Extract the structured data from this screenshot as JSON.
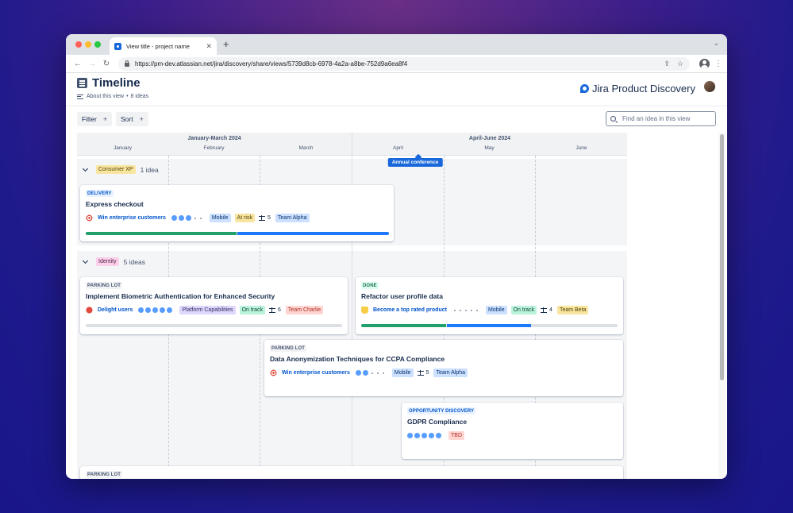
{
  "browser": {
    "tab_title": "View title - project name",
    "url": "https://pm-dev.atlassian.net/jira/discovery/share/views/5739d8cb-6978-4a2a-a8be-752d9a6ea8f4"
  },
  "header": {
    "title": "Timeline",
    "about_label": "About this view",
    "ideas_count": "8 ideas",
    "brand": "Jira Product Discovery"
  },
  "toolbar": {
    "filter_label": "Filter",
    "sort_label": "Sort",
    "plus": "+",
    "search_placeholder": "Find an idea in this view"
  },
  "timeline": {
    "quarters": [
      "January-March 2024",
      "April-June 2024"
    ],
    "months": [
      "January",
      "February",
      "March",
      "April",
      "May",
      "June"
    ],
    "milestone": "Annual conference"
  },
  "groups": [
    {
      "label": "Consumer XP",
      "count": "1 idea",
      "cards": [
        {
          "status": "DELIVERY",
          "title": "Express checkout",
          "goal": "Win enterprise customers",
          "goal_icon": "target-icon",
          "rating": 3,
          "tags": [
            "Mobile",
            "At risk"
          ],
          "effort": "5",
          "team": "Team Alpha",
          "progress": {
            "done": 0.5,
            "in_progress": 0.5
          }
        }
      ]
    },
    {
      "label": "Identity",
      "count": "5 ideas",
      "cards": [
        {
          "status": "PARKING LOT",
          "title": "Implement Biometric Authentication for Enhanced Security",
          "goal": "Delight users",
          "goal_icon": "heart-icon",
          "rating": 5,
          "tags": [
            "Platform Capabilities",
            "On track"
          ],
          "effort": "6",
          "team": "Team Charlie",
          "progress": {
            "done": 0,
            "in_progress": 0
          }
        },
        {
          "status": "DONE",
          "title": "Refactor user profile data",
          "goal": "Become a top rated product",
          "goal_icon": "trophy-icon",
          "rating": 0,
          "tags": [
            "Mobile",
            "On track"
          ],
          "effort": "4",
          "team": "Team Beta",
          "progress": {
            "done": 0.33,
            "in_progress": 0.33
          }
        },
        {
          "status": "PARKING LOT",
          "title": "Data Anonymization Techniques for CCPA Compliance",
          "goal": "Win enterprise customers",
          "goal_icon": "target-icon",
          "rating": 2,
          "tags": [
            "Mobile"
          ],
          "effort": "5",
          "team": "Team Alpha"
        },
        {
          "status": "OPPORTUNITY DISCOVERY",
          "title": "GDPR Compliance",
          "rating": 5,
          "tags": [
            "TBD"
          ]
        },
        {
          "status": "PARKING LOT"
        }
      ]
    }
  ],
  "colors": {
    "brand_blue": "#1868db",
    "progress_done": "#22a06b",
    "progress_in_progress": "#1d7afc"
  }
}
